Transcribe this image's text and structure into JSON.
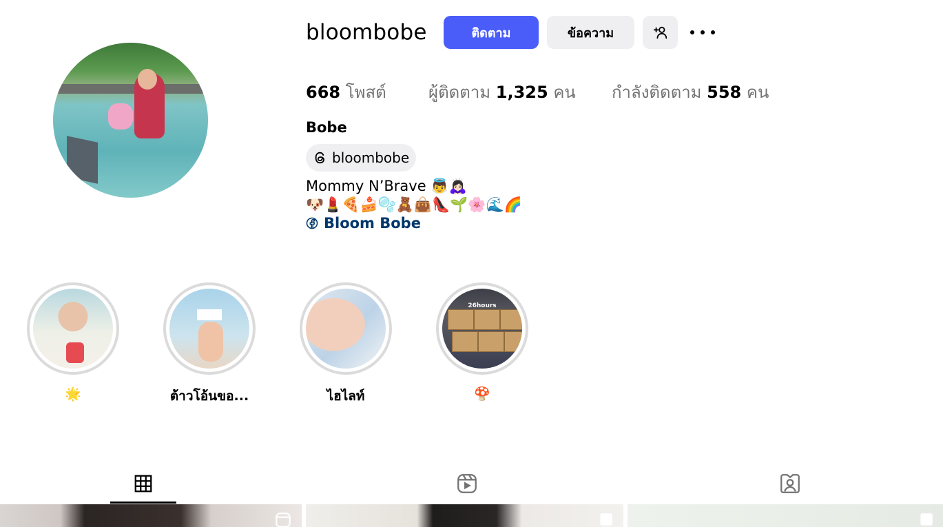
{
  "profile": {
    "username": "bloombobe",
    "follow_label": "ติดตาม",
    "message_label": "ข้อความ",
    "name": "Bobe",
    "threads_handle": "bloombobe",
    "bio_line1": "Mommy N’Brave 👼🙇🏻‍♀️",
    "bio_line2": "🐶💄🍕🍰🫧🧸👜👠🌱🌸🌊🌈",
    "link_label": "Bloom Bobe"
  },
  "stats": {
    "posts_count": "668",
    "posts_label": "โพสต์",
    "followers_label": "ผู้ติดตาม",
    "followers_count": "1,325",
    "followers_unit": "คน",
    "following_label": "กำลังติดตาม",
    "following_count": "558",
    "following_unit": "คน"
  },
  "highlights": [
    {
      "label": "🌟"
    },
    {
      "label": "ต้าวโอ้นขอ..."
    },
    {
      "label": "ไฮไลท์"
    },
    {
      "label": "🍄"
    }
  ],
  "highlight_overlay_text": "26hours",
  "tabs": [
    {
      "icon": "grid-icon",
      "active": true
    },
    {
      "icon": "reels-icon",
      "active": false
    },
    {
      "icon": "tagged-icon",
      "active": false
    }
  ],
  "colors": {
    "accent": "#4a5df9",
    "secondary_button": "#efeff1",
    "link": "#00376b",
    "muted_text": "#737373"
  }
}
